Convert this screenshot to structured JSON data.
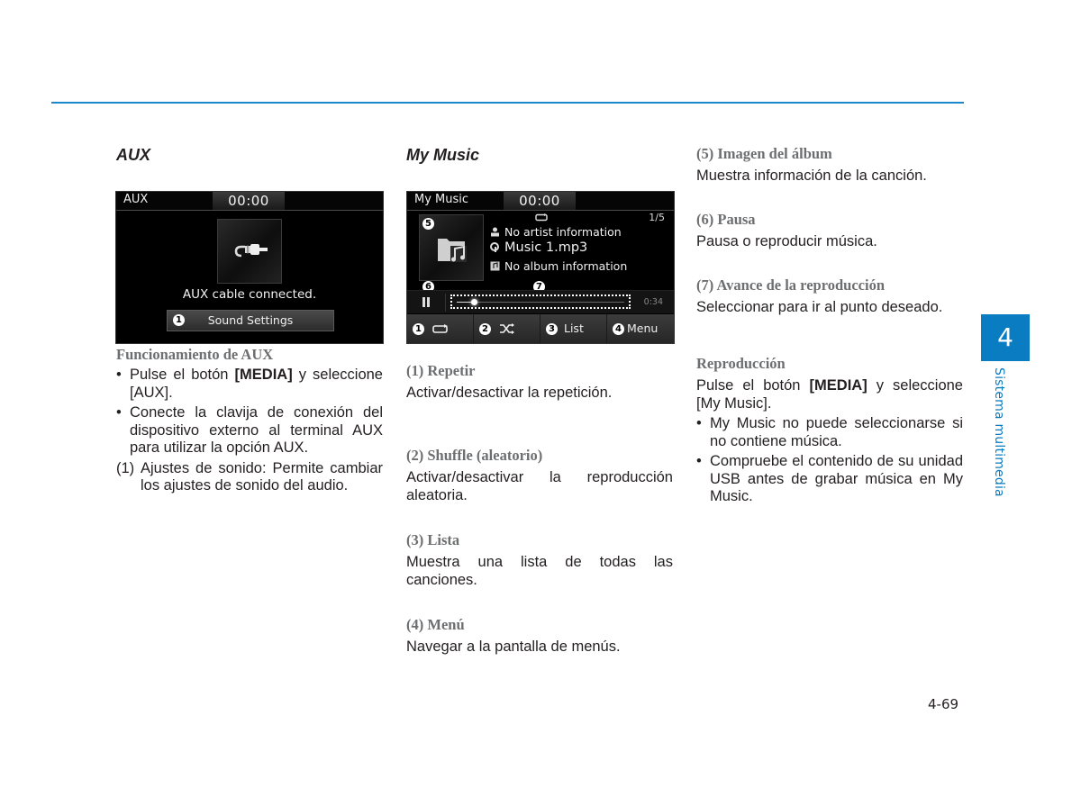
{
  "header": {
    "rule_color": "#1a88c9"
  },
  "columns": {
    "aux": {
      "title": "AUX",
      "screen": {
        "title": "AUX",
        "clock": "00:00",
        "message": "AUX cable connected.",
        "button_badge": "1",
        "button_label": "Sound Settings",
        "art_icon": "aux-cable-icon"
      },
      "subheading": "Funcionamiento de AUX",
      "bullets": [
        {
          "pre": "Pulse el botón ",
          "key": "[MEDIA]",
          "post": " y seleccione [AUX]."
        },
        {
          "text": "Conecte la clavija de conexión del dispositivo externo al terminal AUX para utilizar la opción AUX."
        }
      ],
      "numbered": [
        {
          "num": "(1)",
          "text": "Ajustes de sonido: Permite cambiar los ajustes de sonido del audio."
        }
      ]
    },
    "mymusic": {
      "title": "My Music",
      "screen": {
        "title": "My Music",
        "clock": "00:00",
        "track_counter": "1/5",
        "artist": "No artist information",
        "song": "Music 1.mp3",
        "album": "No album information",
        "elapsed": "0:34",
        "progress_fraction": 0.1,
        "callouts": {
          "art": "5",
          "pause": "6",
          "seek": "7"
        },
        "buttons": [
          {
            "badge": "1",
            "label": "",
            "icon": "repeat-icon"
          },
          {
            "badge": "2",
            "label": "",
            "icon": "shuffle-icon"
          },
          {
            "badge": "3",
            "label": "List"
          },
          {
            "badge": "4",
            "label": "Menu"
          }
        ]
      },
      "items": [
        {
          "heading": "(1) Repetir",
          "text": "Activar/desactivar la repetición."
        },
        {
          "heading": "(2) Shuffle (aleatorio)",
          "text": "Activar/desactivar la reproducción aleatoria."
        },
        {
          "heading": "(3) Lista",
          "text": "Muestra una lista de todas las canciones."
        },
        {
          "heading": "(4) Menú",
          "text": "Navegar a la pantalla de menús."
        }
      ]
    },
    "right": {
      "items": [
        {
          "heading": "(5) Imagen del álbum",
          "text": "Muestra información de la canción."
        },
        {
          "heading": "(6) Pausa",
          "text": "Pausa o reproducir música."
        },
        {
          "heading": "(7) Avance de la reproducción",
          "text": "Seleccionar para ir al punto deseado."
        }
      ],
      "playback": {
        "heading": "Reproducción",
        "intro_pre": "Pulse el botón ",
        "intro_key": "[MEDIA]",
        "intro_post": " y seleccione [My Music].",
        "bullets": [
          "My Music no puede seleccionarse si no contiene música.",
          "Compruebe el contenido de su unidad USB antes de grabar música en My Music."
        ]
      }
    }
  },
  "chapter": {
    "number": "4",
    "label": "Sistema multimedia",
    "color": "#0a7cc2"
  },
  "footer": {
    "page_number": "4-69"
  }
}
